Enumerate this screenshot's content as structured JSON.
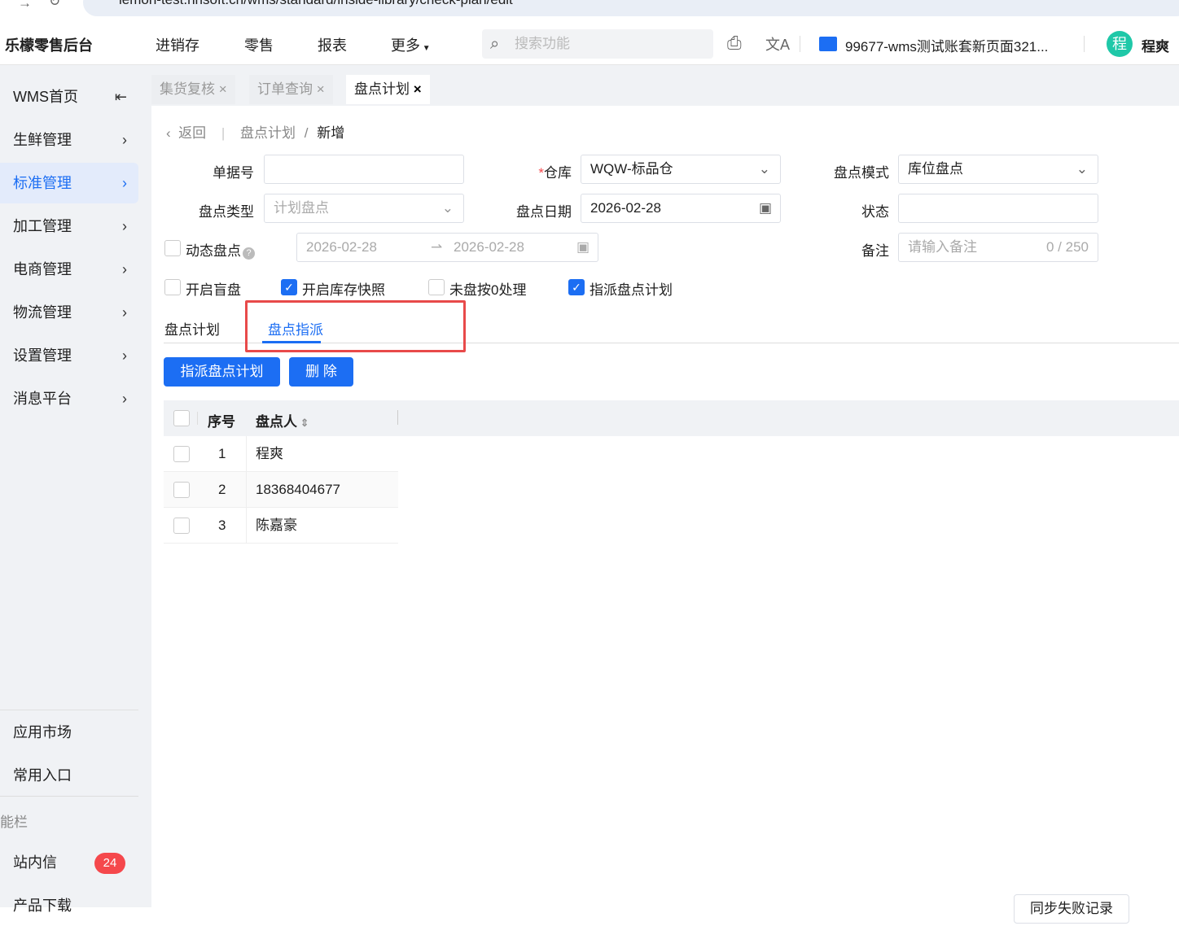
{
  "browser": {
    "url": "lemon-test.hnsoft.cn/wms/standard/inside-library/check-plan/edit"
  },
  "header": {
    "logo": "乐檬零售后台",
    "nav": [
      "进销存",
      "零售",
      "报表",
      "更多"
    ],
    "search_placeholder": "搜索功能",
    "account": "99677-wms测试账套新页面321...",
    "avatar_char": "程",
    "user": "程爽"
  },
  "sidebar": {
    "items": [
      {
        "label": "WMS首页"
      },
      {
        "label": "生鲜管理"
      },
      {
        "label": "标准管理"
      },
      {
        "label": "加工管理"
      },
      {
        "label": "电商管理"
      },
      {
        "label": "物流管理"
      },
      {
        "label": "设置管理"
      },
      {
        "label": "消息平台"
      }
    ],
    "bottom": {
      "market": "应用市场",
      "common": "常用入口",
      "section": "能栏",
      "inbox": "站内信",
      "inbox_badge": "24",
      "download": "产品下载"
    }
  },
  "tabs": [
    {
      "label": "集货复核"
    },
    {
      "label": "订单查询"
    },
    {
      "label": "盘点计划"
    }
  ],
  "breadcrumb": {
    "back": "返回",
    "parent": "盘点计划",
    "sep": "/",
    "current": "新增"
  },
  "form": {
    "doc_no_label": "单据号",
    "doc_no": "",
    "warehouse_label": "仓库",
    "warehouse_required": "*",
    "warehouse": "WQW-标品仓",
    "mode_label": "盘点模式",
    "mode": "库位盘点",
    "type_label": "盘点类型",
    "type": "计划盘点",
    "date_label": "盘点日期",
    "date": "2026-02-28",
    "status_label": "状态",
    "status": "",
    "dynamic_label": "动态盘点",
    "range_start": "2026-02-28",
    "range_end": "2026-02-28",
    "remark_label": "备注",
    "remark_placeholder": "请输入备注",
    "remark_count": "0 / 250",
    "options": [
      {
        "label": "开启盲盘",
        "checked": false
      },
      {
        "label": "开启库存快照",
        "checked": true
      },
      {
        "label": "未盘按0处理",
        "checked": false
      },
      {
        "label": "指派盘点计划",
        "checked": true
      }
    ]
  },
  "subtabs": [
    "盘点计划",
    "盘点指派"
  ],
  "actions": {
    "assign": "指派盘点计划",
    "delete": "删 除"
  },
  "table": {
    "headers": [
      "序号",
      "盘点人"
    ],
    "rows": [
      {
        "no": "1",
        "name": "程爽"
      },
      {
        "no": "2",
        "name": "18368404677"
      },
      {
        "no": "3",
        "name": "陈嘉豪"
      }
    ]
  },
  "footer_button": "同步失败记录",
  "colors": {
    "primary": "#1c6ef3",
    "highlight": "#e84a4a"
  }
}
